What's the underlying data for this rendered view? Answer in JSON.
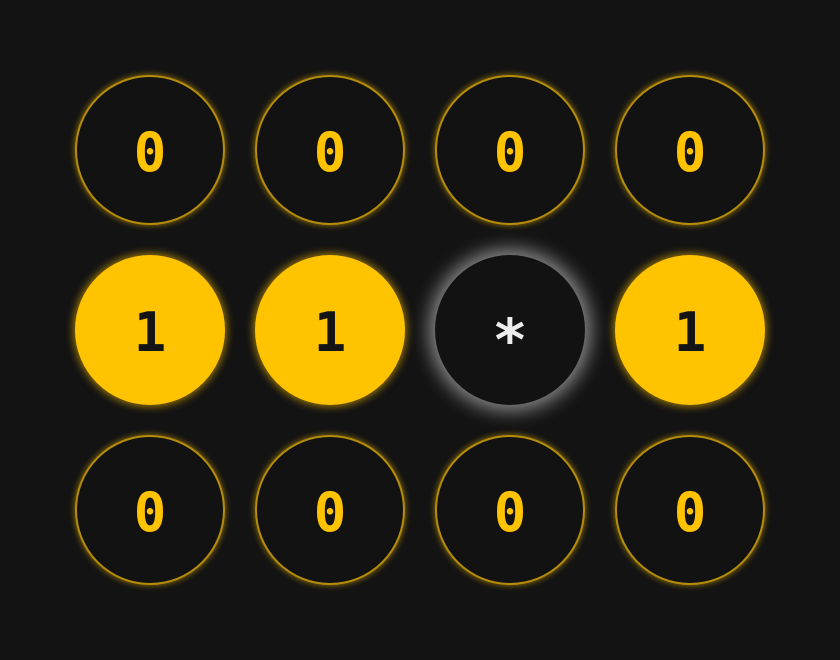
{
  "colors": {
    "background": "#131313",
    "accent": "#ffc300",
    "cursor_glow": "#ededed"
  },
  "board": {
    "rows": [
      [
        {
          "value": "0",
          "state": "off"
        },
        {
          "value": "0",
          "state": "off"
        },
        {
          "value": "0",
          "state": "off"
        },
        {
          "value": "0",
          "state": "off"
        }
      ],
      [
        {
          "value": "1",
          "state": "on"
        },
        {
          "value": "1",
          "state": "on"
        },
        {
          "value": "*",
          "state": "cursor"
        },
        {
          "value": "1",
          "state": "on"
        }
      ],
      [
        {
          "value": "0",
          "state": "off"
        },
        {
          "value": "0",
          "state": "off"
        },
        {
          "value": "0",
          "state": "off"
        },
        {
          "value": "0",
          "state": "off"
        }
      ]
    ]
  }
}
